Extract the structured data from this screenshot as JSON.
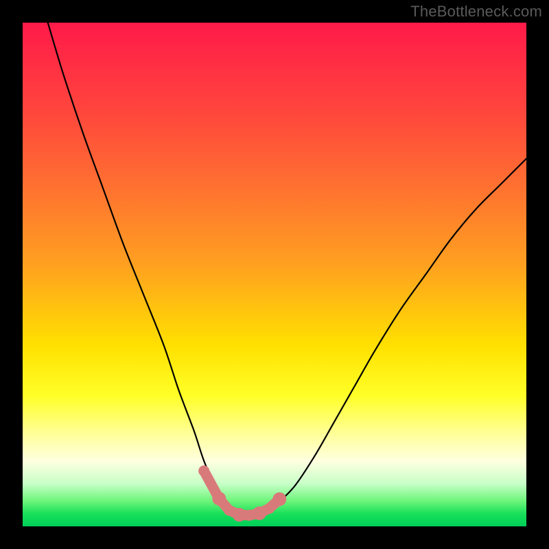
{
  "watermark": "TheBottleneck.com",
  "colors": {
    "frame": "#000000",
    "curve_stroke": "#000000",
    "marker_fill": "#d97a7a",
    "gradient_top": "#ff1a49",
    "gradient_bottom": "#00cf58"
  },
  "chart_data": {
    "type": "line",
    "title": "",
    "xlabel": "",
    "ylabel": "",
    "xlim": [
      0,
      100
    ],
    "ylim": [
      0,
      100
    ],
    "series": [
      {
        "name": "bottleneck-curve",
        "x": [
          5,
          8,
          12,
          16,
          20,
          24,
          28,
          31,
          34,
          36,
          38,
          40,
          42,
          44,
          46,
          48,
          50,
          54,
          58,
          62,
          66,
          70,
          75,
          80,
          85,
          90,
          95,
          100
        ],
        "y": [
          100,
          90,
          78,
          67,
          56,
          46,
          36,
          27,
          19,
          13,
          8.5,
          5,
          3,
          2,
          2,
          2.5,
          4,
          8,
          14,
          21,
          28,
          35,
          43,
          50,
          57,
          63,
          68,
          73
        ]
      },
      {
        "name": "optimal-markers",
        "x": [
          36,
          39,
          41,
          43,
          45,
          47,
          49,
          51
        ],
        "y": [
          11,
          5.5,
          3.2,
          2.3,
          2.2,
          2.6,
          3.6,
          5.4
        ]
      }
    ],
    "notes": "x is a normalized component-balance axis (0–100); y is bottleneck percentage (0 best, 100 worst). The curve minimum near x≈44 is the balanced configuration. Salmon markers highlight the near-optimal region. Background gradient encodes y: red (high bottleneck) at top → green (no bottleneck) at bottom."
  }
}
